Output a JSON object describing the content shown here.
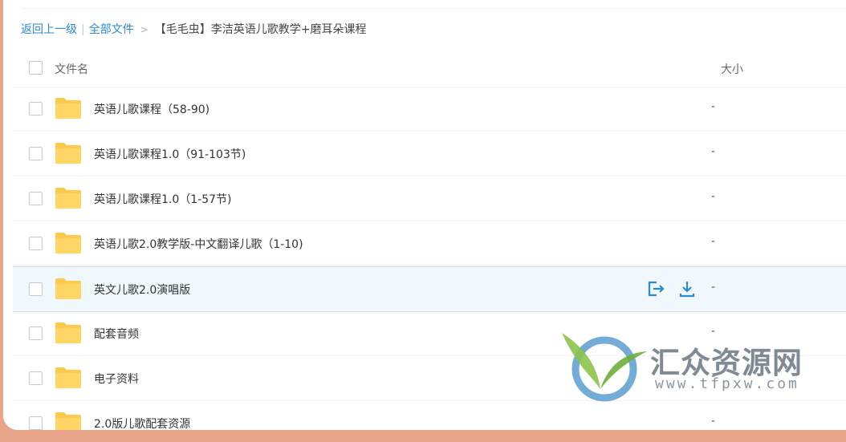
{
  "breadcrumb": {
    "back": "返回上一级",
    "divider": "|",
    "all_files": "全部文件",
    "arrow": ">",
    "current": "【毛毛虫】李洁英语儿歌教学+磨耳朵课程"
  },
  "table": {
    "col_name": "文件名",
    "col_size": "大小"
  },
  "rows": [
    {
      "name": "英语儿歌课程（58-90)",
      "size": "-"
    },
    {
      "name": "英语儿歌课程1.0（91-103节)",
      "size": "-"
    },
    {
      "name": "英语儿歌课程1.0（1-57节)",
      "size": "-"
    },
    {
      "name": "英语儿歌2.0教学版-中文翻译儿歌（1-10)",
      "size": "-"
    },
    {
      "name": "英文儿歌2.0演唱版",
      "size": "-"
    },
    {
      "name": "配套音频",
      "size": "-"
    },
    {
      "name": "电子资料",
      "size": "-"
    },
    {
      "name": "2.0版儿歌配套资源",
      "size": "-"
    }
  ],
  "colors": {
    "accent": "#2a8ad6",
    "folder": "#ffc94d",
    "hover_row": "#f1f8fc",
    "background": "#e8a58a"
  },
  "icons": {
    "folder": "folder-icon",
    "share": "share-icon",
    "download": "download-icon"
  },
  "watermark": {
    "title": "汇众资源网",
    "url": "www.tfpxw.com"
  }
}
